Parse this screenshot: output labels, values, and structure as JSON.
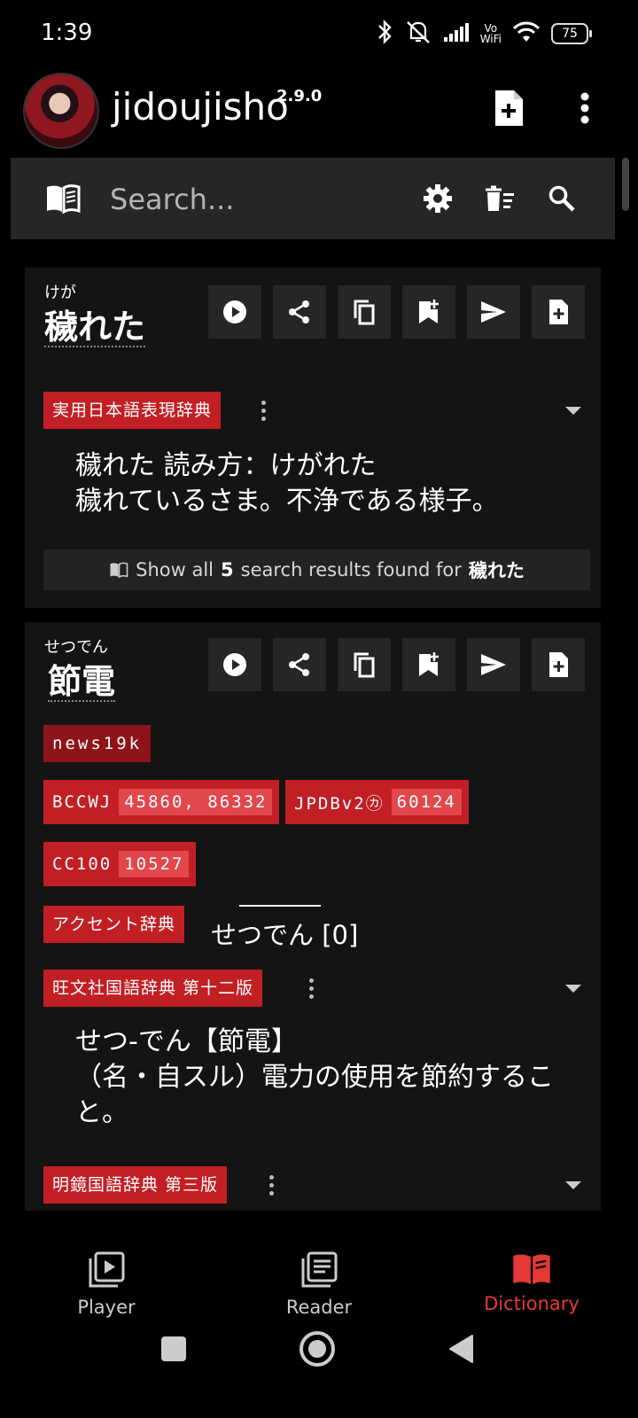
{
  "status": {
    "time": "1:39",
    "battery": "75",
    "vowifi_top": "Vo",
    "vowifi_bottom": "WiFi"
  },
  "app": {
    "title": "jidoujisho",
    "version": "2.9.0"
  },
  "search": {
    "placeholder": "Search..."
  },
  "entries": [
    {
      "reading": "けが",
      "term": "穢れた",
      "dictionaries": [
        {
          "name": "実用日本語表現辞典",
          "gloss": [
            "穢れた 読み方：けがれた",
            "穢れているさま。不浄である様子。"
          ]
        }
      ],
      "show_all": {
        "prefix": "Show all",
        "count": "5",
        "middle": "search results found for",
        "term": "穢れた"
      }
    },
    {
      "reading": "せつでん",
      "term": "節電",
      "tags": [
        "news19k"
      ],
      "frequencies": [
        {
          "name": "BCCWJ",
          "value": "45860, 86332"
        },
        {
          "name": "JPDBv2㋕",
          "value": "60124"
        },
        {
          "name": "CC100",
          "value": "10527"
        }
      ],
      "pitch": {
        "dict": "アクセント辞典",
        "text": "せつでん [0]"
      },
      "dictionaries": [
        {
          "name": "旺文社国語辞典 第十二版",
          "gloss": [
            "せつ‐でん【節電】",
            "（名・自スル）電力の使用を節約するこ",
            "と。"
          ]
        },
        {
          "name": "明鏡国語辞典 第三版"
        }
      ]
    }
  ],
  "nav": {
    "player": "Player",
    "reader": "Reader",
    "dictionary": "Dictionary"
  },
  "colors": {
    "accent": "#c21f24",
    "active_nav": "#e53935"
  }
}
